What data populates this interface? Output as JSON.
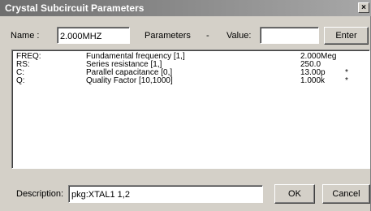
{
  "window": {
    "title": "Crystal Subcircuit Parameters",
    "close_glyph": "×"
  },
  "name_label": "Name :",
  "name_value": "2.000MHZ",
  "parameters_label": "Parameters",
  "dash": "-",
  "value_label": "Value:",
  "value_value": "",
  "enter_label": "Enter",
  "params": [
    {
      "name": "FREQ:",
      "desc": "Fundamental frequency [1,]",
      "value": "2.000Meg",
      "flag": ""
    },
    {
      "name": "RS:",
      "desc": "Series resistance [1,]",
      "value": "250.0",
      "flag": ""
    },
    {
      "name": "C:",
      "desc": "Parallel capacitance [0,]",
      "value": "13.00p",
      "flag": "*"
    },
    {
      "name": "Q:",
      "desc": "Quality Factor [10,1000]",
      "value": "1.000k",
      "flag": "*"
    }
  ],
  "description_label": "Description:",
  "description_value": "pkg:XTAL1 1,2",
  "ok_label": "OK",
  "cancel_label": "Cancel"
}
